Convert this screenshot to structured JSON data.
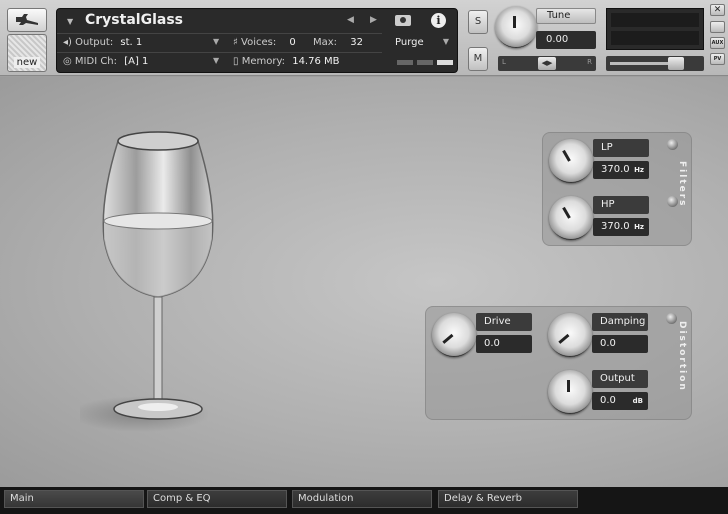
{
  "header": {
    "instrument_name": "CrystalGlass",
    "output_label": "Output:",
    "output_value": "st. 1",
    "voices_label": "Voices:",
    "voices_value": "0",
    "max_label": "Max:",
    "max_value": "32",
    "midi_label": "MIDI Ch:",
    "midi_value": "[A]  1",
    "memory_label": "Memory:",
    "memory_value": "14.76 MB",
    "purge_label": "Purge",
    "solo_label": "S",
    "mute_label": "M",
    "tune_label": "Tune",
    "tune_value": "0.00",
    "pan_left": "L",
    "pan_right": "R",
    "pan_center": "◀▶",
    "aux_label": "AUX",
    "pv_label": "PV",
    "close_label": "✕",
    "new_label": "new",
    "icons": [
      "wrench-icon",
      "camera-icon",
      "info-icon",
      "prev-arrow-icon",
      "next-arrow-icon",
      "close-icon"
    ]
  },
  "filters": {
    "title": "Filters",
    "lp": {
      "label": "LP",
      "value": "370.0",
      "unit": "Hz"
    },
    "hp": {
      "label": "HP",
      "value": "370.0",
      "unit": "Hz"
    }
  },
  "distortion": {
    "title": "Distortion",
    "drive": {
      "label": "Drive",
      "value": "0.0"
    },
    "damping": {
      "label": "Damping",
      "value": "0.0"
    },
    "output": {
      "label": "Output",
      "value": "0.0",
      "unit": "dB"
    }
  },
  "tabs": [
    {
      "label": "Main",
      "active": true
    },
    {
      "label": "Comp & EQ",
      "active": false
    },
    {
      "label": "Modulation",
      "active": false
    },
    {
      "label": "Delay & Reverb",
      "active": false
    }
  ]
}
